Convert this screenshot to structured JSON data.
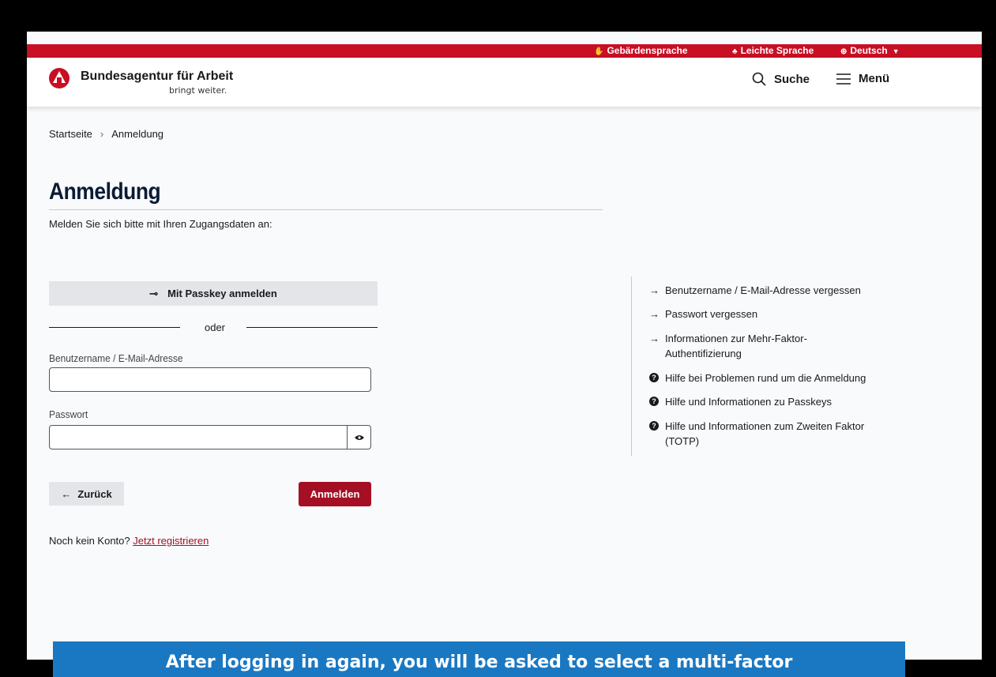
{
  "topbar": {
    "sign_language": "Gebärdensprache",
    "easy_language": "Leichte Sprache",
    "language": "Deutsch"
  },
  "header": {
    "brand_name": "Bundesagentur für Arbeit",
    "brand_tagline": "bringt weiter.",
    "search_label": "Suche",
    "menu_label": "Menü"
  },
  "breadcrumb": {
    "home": "Startseite",
    "current": "Anmeldung"
  },
  "main": {
    "title": "Anmeldung",
    "intro": "Melden Sie sich bitte mit Ihren Zugangsdaten an:",
    "passkey_button": "Mit Passkey anmelden",
    "divider_text": "oder",
    "username_label": "Benutzername / E-Mail-Adresse",
    "username_value": "",
    "password_label": "Passwort",
    "password_value": "",
    "back_button": "Zurück",
    "login_button": "Anmelden",
    "no_account_text": "Noch kein Konto?",
    "register_link": "Jetzt registrieren"
  },
  "side_links": [
    {
      "label": "Benutzername / E-Mail-Adresse vergessen",
      "icon": "arrow-right-icon"
    },
    {
      "label": "Passwort vergessen",
      "icon": "arrow-right-icon"
    },
    {
      "label": "Informationen zur Mehr-Faktor-Authentifizierung",
      "icon": "arrow-right-icon"
    },
    {
      "label": "Hilfe bei Problemen rund um die Anmeldung",
      "icon": "question-circle-icon"
    },
    {
      "label": "Hilfe und Informationen zu Passkeys",
      "icon": "question-circle-icon"
    },
    {
      "label": "Hilfe und Informationen zum Zweiten Faktor (TOTP)",
      "icon": "question-circle-icon"
    }
  ],
  "banner": {
    "text": "After logging in again, you will be asked to select a multi-factor"
  },
  "colors": {
    "brand_red": "#c80f23",
    "button_red": "#a50f23",
    "banner_blue": "#1a78c2"
  }
}
